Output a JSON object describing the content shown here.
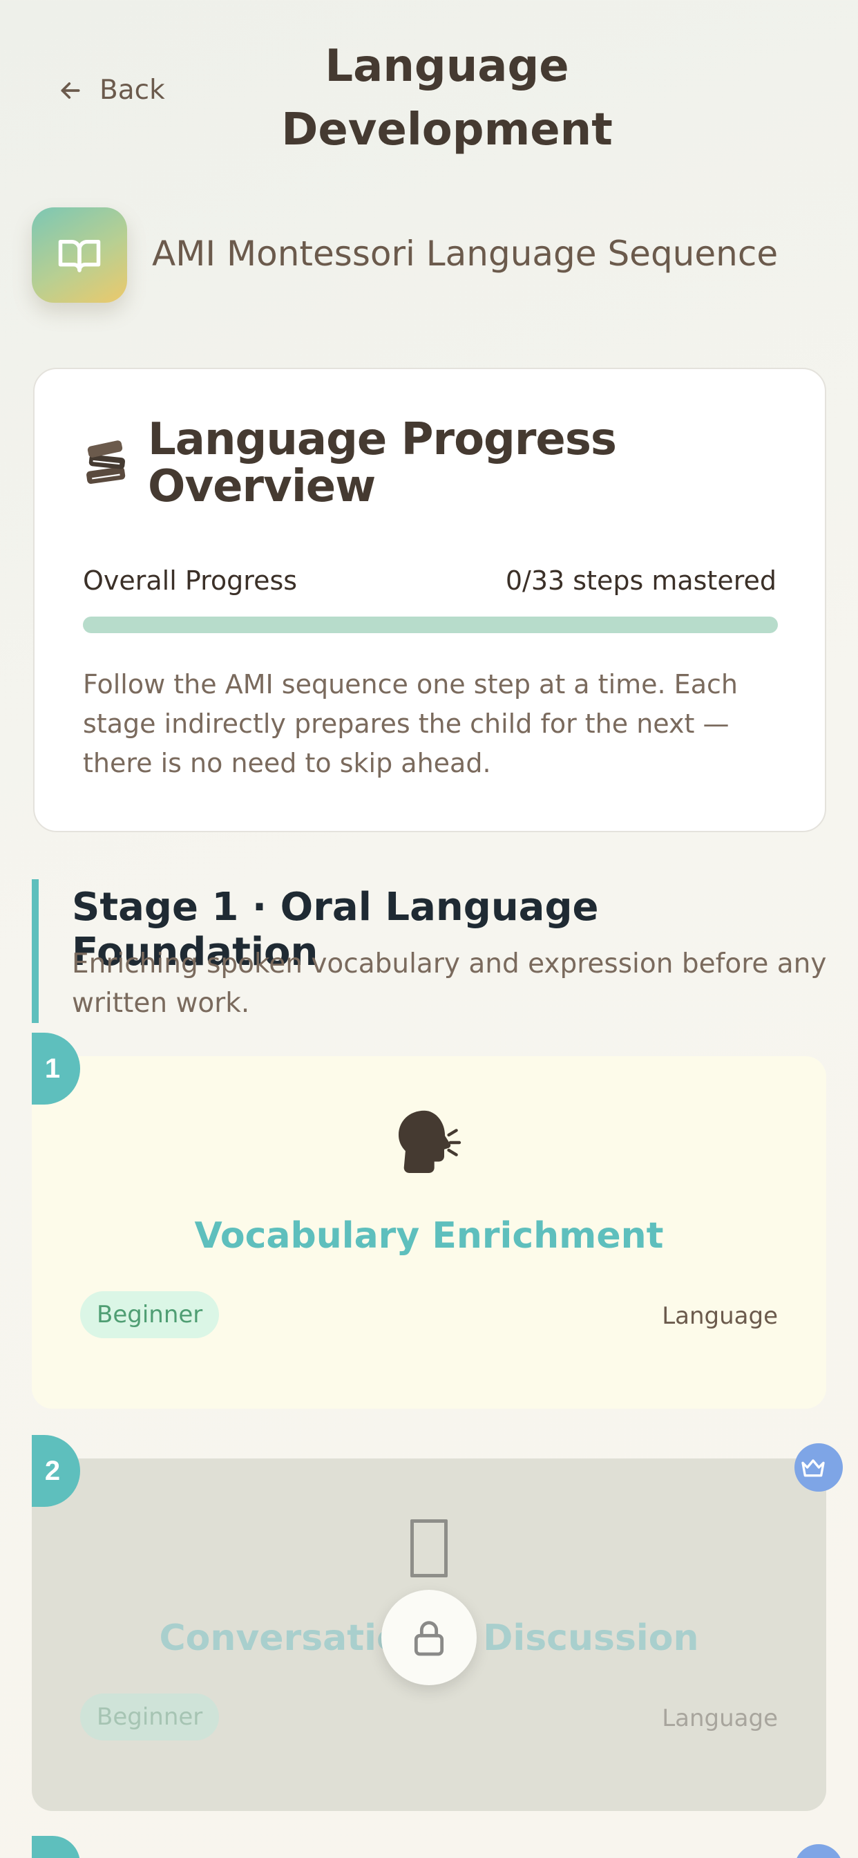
{
  "header": {
    "back_label": "Back",
    "title": "Language Development"
  },
  "subtitle": {
    "icon": "book-open-icon",
    "text": "AMI Montessori Language Sequence"
  },
  "overview": {
    "icon": "books-icon",
    "title": "Language Progress Overview",
    "progress_label": "Overall Progress",
    "progress_text": "0/33 steps mastered",
    "progress_value": 0,
    "progress_total": 33,
    "description": "Follow the AMI sequence one step at a time. Each stage indirectly prepares the child for the next — there is no need to skip ahead."
  },
  "stage": {
    "title": "Stage 1 · Oral Language Foundation",
    "description": "Enriching spoken vocabulary and expression before any written work."
  },
  "steps": [
    {
      "number": "1",
      "icon": "speaking-head-icon",
      "title": "Vocabulary Enrichment",
      "level": "Beginner",
      "category": "Language",
      "locked": false
    },
    {
      "number": "2",
      "icon": "missing-glyph-icon",
      "title": "Conversation & Discussion",
      "level": "Beginner",
      "category": "Language",
      "locked": true
    }
  ],
  "colors": {
    "accent_teal": "#5ebfbd",
    "text_brown": "#453a31",
    "card_unlocked": "#fdfbea",
    "card_locked": "#dfdfd5",
    "premium_blue": "#7ea5e6"
  }
}
